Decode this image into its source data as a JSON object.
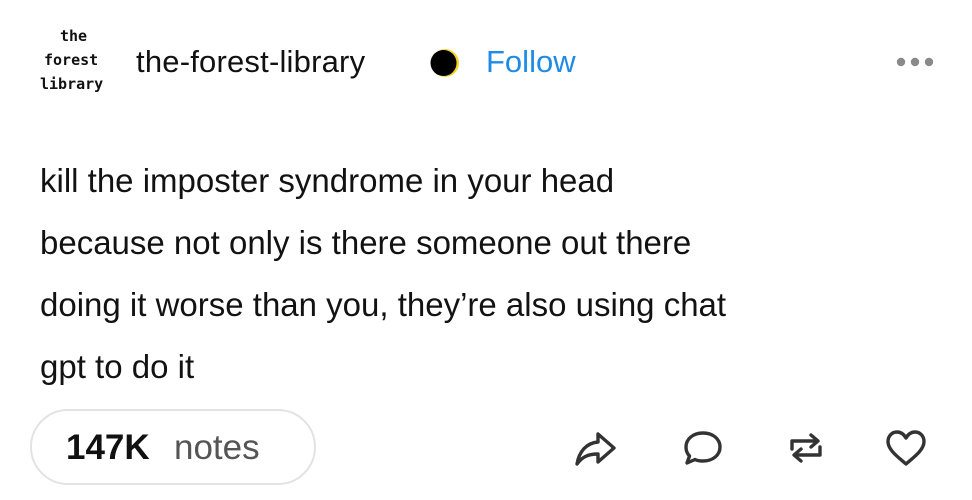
{
  "header": {
    "avatar_lines": [
      "the",
      "forest",
      "library"
    ],
    "blog_name": "the-forest-library",
    "follow_label": "Follow",
    "badge_icon": "moon-icon",
    "more_icon": "more-options-icon",
    "accent_color": "#1e8be6"
  },
  "post": {
    "lines": [
      "kill the imposter syndrome in your head",
      "because not only is there someone out there",
      "doing it worse than you, they’re also using chat",
      "gpt to do it"
    ]
  },
  "footer": {
    "notes_count": "147K",
    "notes_label": "notes",
    "actions": [
      "share-icon",
      "reply-icon",
      "reblog-icon",
      "like-icon"
    ]
  }
}
